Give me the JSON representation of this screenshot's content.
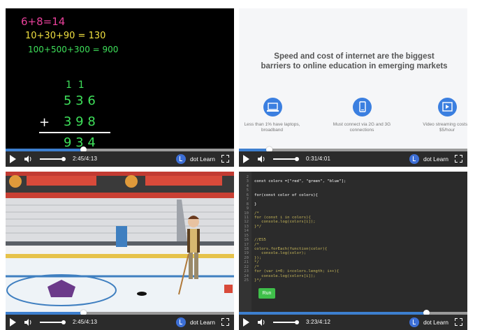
{
  "players": [
    {
      "time": "2:45/4:13",
      "brand": "dot Learn",
      "progress": 0.34
    },
    {
      "time": "0:31/4:01",
      "brand": "dot Learn",
      "progress": 0.13
    },
    {
      "time": "2:45/4:13",
      "brand": "dot Learn",
      "progress": 0.34
    },
    {
      "time": "3:23/4:12",
      "brand": "dot Learn",
      "progress": 0.82
    }
  ],
  "math": {
    "line1": "6+8=14",
    "line2": "10+30+90 = 130",
    "line3": "100+500+300 = 900",
    "carry": "1  1",
    "top": "5 3 6",
    "plus": "+",
    "bottom": "3 9 8",
    "result": "9 3 4"
  },
  "slide": {
    "title": "Speed and cost of internet are the biggest barriers to online education in emerging markets",
    "barriers": [
      {
        "label": "Less than 1%  have laptops, broadband",
        "icon": "laptop-icon"
      },
      {
        "label": "Must connect via 2G and 3G connections",
        "icon": "phone-icon"
      },
      {
        "label": "Video streaming costs > $5/hour",
        "icon": "video-icon"
      }
    ]
  },
  "code": {
    "lines": [
      {
        "n": "2",
        "t": "",
        "c": "#ffffff"
      },
      {
        "n": "3",
        "t": "const colors =[\"red\", \"green\", \"blue\"];",
        "c": "#ffffff"
      },
      {
        "n": "4",
        "t": "",
        "c": "#ffffff"
      },
      {
        "n": "5",
        "t": "",
        "c": "#ffffff"
      },
      {
        "n": "6",
        "t": "for(const color of colors){",
        "c": "#ffffff"
      },
      {
        "n": "7",
        "t": "",
        "c": "#ffffff"
      },
      {
        "n": "8",
        "t": "}",
        "c": "#ffffff"
      },
      {
        "n": "9",
        "t": "",
        "c": "#ffffff"
      },
      {
        "n": "10",
        "t": "/*",
        "c": "#c8b85a"
      },
      {
        "n": "11",
        "t": "for (const i in colors){",
        "c": "#c8b85a"
      },
      {
        "n": "12",
        "t": "   console.log(colors[i]);",
        "c": "#c8b85a"
      },
      {
        "n": "13",
        "t": "}*/",
        "c": "#c8b85a"
      },
      {
        "n": "14",
        "t": "",
        "c": "#c8b85a"
      },
      {
        "n": "15",
        "t": "",
        "c": "#c8b85a"
      },
      {
        "n": "16",
        "t": "//ES5",
        "c": "#c8b85a"
      },
      {
        "n": "17",
        "t": "/*",
        "c": "#c8b85a"
      },
      {
        "n": "18",
        "t": "colors.forEach(function(color){",
        "c": "#c8b85a"
      },
      {
        "n": "19",
        "t": "   console.log(color);",
        "c": "#c8b85a"
      },
      {
        "n": "20",
        "t": "});",
        "c": "#c8b85a"
      },
      {
        "n": "21",
        "t": "*/",
        "c": "#c8b85a"
      },
      {
        "n": "22",
        "t": "/*",
        "c": "#c8b85a"
      },
      {
        "n": "23",
        "t": "for (var i=0; i<colors.length; i++){",
        "c": "#c8b85a"
      },
      {
        "n": "24",
        "t": "   console.log(colors[i]);",
        "c": "#c8b85a"
      },
      {
        "n": "25",
        "t": "}*/",
        "c": "#c8b85a"
      }
    ],
    "run_label": "Run"
  }
}
